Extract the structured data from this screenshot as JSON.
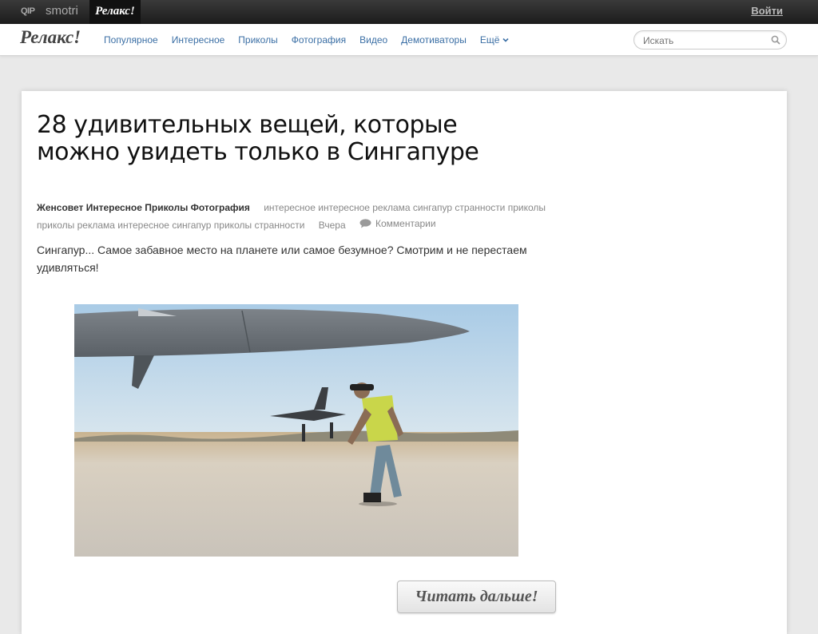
{
  "topbar": {
    "links": [
      "QIP",
      "smotri",
      "Релакс!"
    ],
    "login": "Войти"
  },
  "header": {
    "logo": "Релакс!",
    "nav": [
      "Популярное",
      "Интересное",
      "Приколы",
      "Фотография",
      "Видео",
      "Демотиваторы",
      "Ещё"
    ],
    "search_placeholder": "Искать"
  },
  "article": {
    "title": "28 удивительных вещей, которые можно увидеть только в Сингапуре",
    "categories": "Женсовет Интересное Приколы Фотография",
    "tags": "интересное интересное реклама сингапур странности приколы приколы реклама интересное сингапур приколы странности",
    "date": "Вчера",
    "comments": "Комментарии",
    "lead": "Сингапур... Самое забавное место на планете или самое безумное? Смотрим и не перестаем удивляться!",
    "read_more": "Читать дальше!"
  },
  "colors": {
    "link": "#3b6fa5",
    "topbar": "#1c1c1c",
    "page_bg": "#e9e9e9"
  }
}
